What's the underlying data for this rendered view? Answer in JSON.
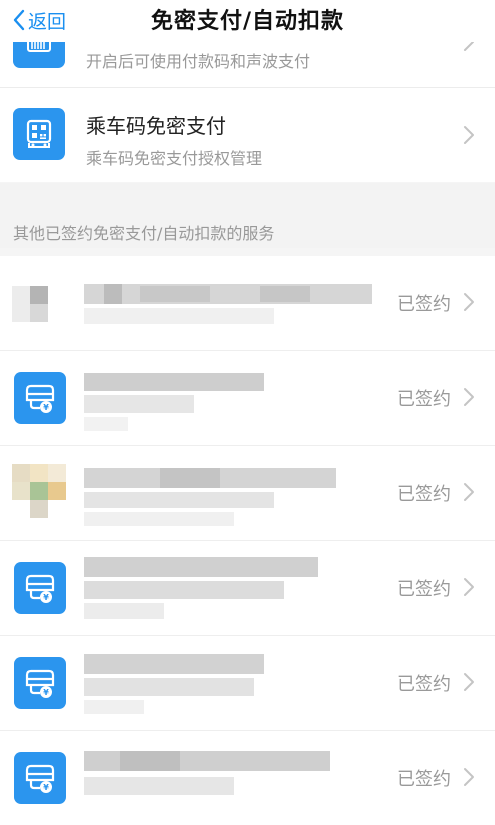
{
  "nav": {
    "back_label": "返回",
    "title": "免密支付/自动扣款"
  },
  "top_items": [
    {
      "subtitle": "开启后可使用付款码和声波支付",
      "icon": "pay-code-icon"
    },
    {
      "title": "乘车码免密支付",
      "subtitle": "乘车码免密支付授权管理",
      "icon": "bus-code-icon"
    }
  ],
  "section_header": "其他已签约免密支付/自动扣款的服务",
  "services": [
    {
      "status": "已签约",
      "icon": "blurred-logo"
    },
    {
      "status": "已签约",
      "icon": "wallet-yuan-icon"
    },
    {
      "status": "已签约",
      "icon": "blurred-logo"
    },
    {
      "status": "已签约",
      "icon": "wallet-yuan-icon"
    },
    {
      "status": "已签约",
      "icon": "wallet-yuan-icon"
    },
    {
      "status": "已签约",
      "icon": "wallet-yuan-icon"
    }
  ],
  "colors": {
    "accent": "#1a8ff0",
    "icon_bg": "#2b95ee",
    "muted_text": "#999999"
  }
}
